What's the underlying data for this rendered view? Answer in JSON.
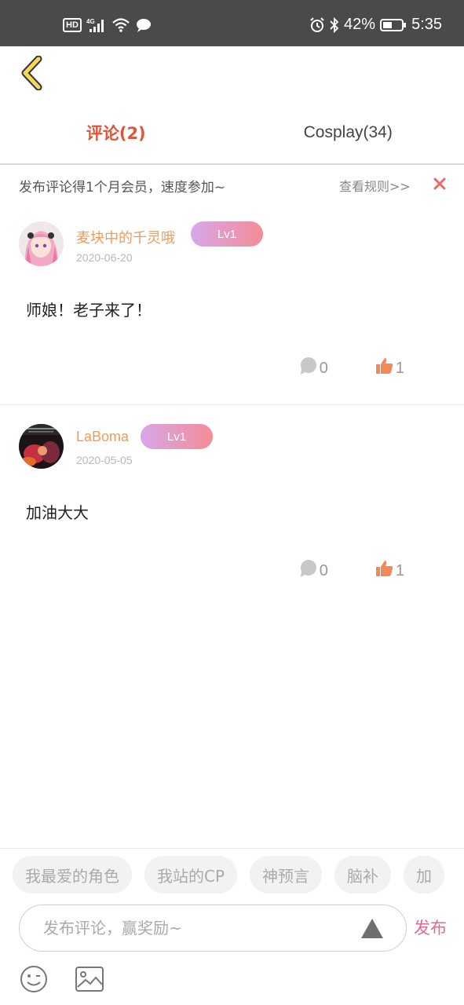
{
  "status_bar": {
    "hd": "HD",
    "network": "4G",
    "battery": "42%",
    "time": "5:35"
  },
  "tabs": [
    {
      "label": "评论(2)",
      "active": true
    },
    {
      "label": "Cosplay(34)",
      "active": false
    }
  ],
  "notice": {
    "text": "发布评论得1个月会员，速度参加~",
    "link": "查看规则>>"
  },
  "comments": [
    {
      "username": "麦块中的千灵哦",
      "level": "Lv1",
      "date": "2020-06-20",
      "text": "师娘！老子来了！",
      "reply_count": "0",
      "like_count": "1"
    },
    {
      "username": "LaBoma",
      "level": "Lv1",
      "date": "2020-05-05",
      "text": "加油大大",
      "reply_count": "0",
      "like_count": "1"
    }
  ],
  "quick_tags": [
    "我最爱的角色",
    "我站的CP",
    "神预言",
    "脑补",
    "加"
  ],
  "composer": {
    "placeholder": "发布评论，赢奖励~",
    "publish_label": "发布"
  },
  "colors": {
    "accent": "#e0553a",
    "username": "#ee9c5c",
    "like": "#f08a5d",
    "publish": "#e26a95"
  }
}
